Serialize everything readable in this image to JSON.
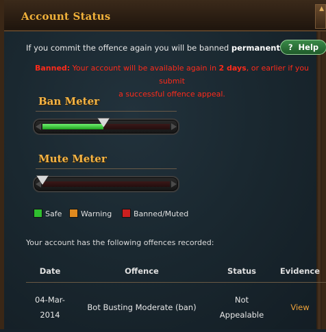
{
  "window": {
    "title": "Account Status"
  },
  "intro": {
    "prefix": "If you commit the offence again you will be banned ",
    "emphasis": "permanently",
    "suffix": "."
  },
  "help_button": {
    "icon": "?",
    "label": "Help"
  },
  "banned_notice": {
    "label": "Banned:",
    "text_before": " Your account will be available again in ",
    "duration": "2 days",
    "text_after": ", or earlier if you submit",
    "line2": "a successful offence appeal."
  },
  "meters": {
    "ban": {
      "title": "Ban Meter",
      "level": 0.48
    },
    "mute": {
      "title": "Mute Meter",
      "level": 0.0
    }
  },
  "legend": {
    "items": [
      {
        "label": "Safe",
        "color": "#2fbf2f"
      },
      {
        "label": "Warning",
        "color": "#e08a1f"
      },
      {
        "label": "Banned/Muted",
        "color": "#cc1f1f"
      }
    ]
  },
  "recorded_text": "Your account has the following offences recorded:",
  "table": {
    "headers": [
      "Date",
      "Offence",
      "Status",
      "Evidence"
    ],
    "rows": [
      {
        "date_line1": "04-Mar-",
        "date_line2": "2014",
        "offence": "Bot Busting Moderate (ban)",
        "status_line1": "Not",
        "status_line2": "Appealable",
        "evidence": "View"
      }
    ]
  },
  "colors": {
    "title_gold": "#f0b13a",
    "banned_red": "#ff2a1a",
    "link_orange": "#f0a43a",
    "help_green": "#2f7a3a"
  }
}
